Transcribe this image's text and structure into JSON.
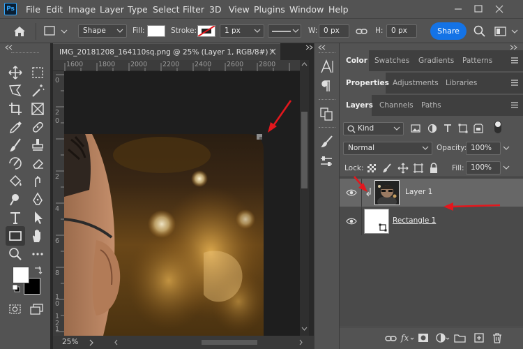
{
  "menubar": {
    "app_logo": "Ps",
    "items": [
      "File",
      "Edit",
      "Image",
      "Layer",
      "Type",
      "Select",
      "Filter",
      "3D",
      "View",
      "Plugins",
      "Window",
      "Help"
    ],
    "window_controls": [
      "minimize-icon",
      "maximize-icon",
      "close-icon"
    ]
  },
  "options": {
    "home_icon": "home-icon",
    "shape_mode": "Shape",
    "fill_label": "Fill:",
    "stroke_label": "Stroke:",
    "stroke_width": "1 px",
    "w_label": "W:",
    "w_value": "0 px",
    "h_label": "H:",
    "h_value": "0 px",
    "share_label": "Share"
  },
  "document": {
    "tab_title": "IMG_20181208_164110sq.png @ 25% (Layer 1, RGB/8#) *",
    "ruler_top": [
      "1600",
      "1800",
      "2000",
      "2200",
      "2400",
      "2600",
      "2800"
    ],
    "ruler_left": [
      "0",
      "2",
      "0",
      "2",
      "4",
      "6",
      "8",
      "1",
      "0",
      "1",
      "2",
      "1",
      "4"
    ],
    "zoom": "25%"
  },
  "panels": {
    "row1_tabs": [
      "Color",
      "Swatches",
      "Gradients",
      "Patterns"
    ],
    "row2_tabs": [
      "Properties",
      "Adjustments",
      "Libraries"
    ],
    "row3_tabs": [
      "Layers",
      "Channels",
      "Paths"
    ],
    "kind_filter": "Kind",
    "blend_mode": "Normal",
    "opacity_label": "Opacity:",
    "opacity_value": "100%",
    "lock_label": "Lock:",
    "fill_label": "Fill:",
    "fill_value": "100%"
  },
  "layers": [
    {
      "name": "Layer 1",
      "selected": true,
      "clipped": true
    },
    {
      "name": "Rectangle 1",
      "selected": false,
      "clipped": false
    }
  ],
  "colors": {
    "accent": "#1473e6",
    "annotation_arrow": "#e3171d",
    "foreground": "#ffffff",
    "background": "#000000"
  }
}
